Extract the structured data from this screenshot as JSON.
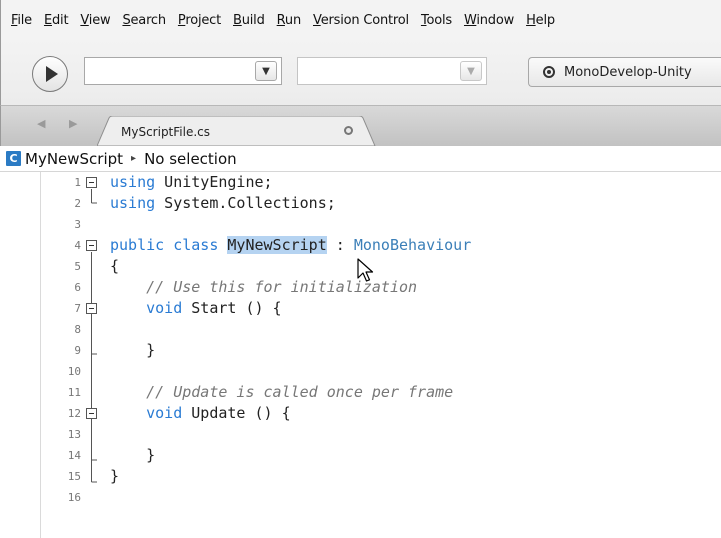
{
  "menu": [
    {
      "label": "File",
      "key": "F",
      "rest": "ile"
    },
    {
      "label": "Edit",
      "key": "E",
      "rest": "dit"
    },
    {
      "label": "View",
      "key": "V",
      "rest": "iew"
    },
    {
      "label": "Search",
      "key": "S",
      "rest": "earch"
    },
    {
      "label": "Project",
      "key": "P",
      "rest": "roject"
    },
    {
      "label": "Build",
      "key": "B",
      "rest": "uild"
    },
    {
      "label": "Run",
      "key": "R",
      "rest": "un"
    },
    {
      "label": "Version Control",
      "key": "V",
      "rest": "ersion Control"
    },
    {
      "label": "Tools",
      "key": "T",
      "rest": "ools"
    },
    {
      "label": "Window",
      "key": "W",
      "rest": "indow"
    },
    {
      "label": "Help",
      "key": "H",
      "rest": "elp"
    }
  ],
  "toolbar": {
    "run_icon": "play-icon",
    "configuration_value": "",
    "platform_value": "",
    "target_label": "MonoDevelop-Unity",
    "target_icon": "radio-target-icon"
  },
  "tabs": [
    {
      "label": "MyScriptFile.cs",
      "modified_icon": "unsaved-dot-icon"
    }
  ],
  "breadcrumb": {
    "icon_letter": "C",
    "class_name": "MyNewScript",
    "separator": "▸",
    "member": "No selection"
  },
  "editor": {
    "lines": [
      {
        "n": "1",
        "text": "using UnityEngine;"
      },
      {
        "n": "2",
        "text": "using System.Collections;"
      },
      {
        "n": "3",
        "text": ""
      },
      {
        "n": "4",
        "text": "public class MyNewScript : MonoBehaviour"
      },
      {
        "n": "5",
        "text": "{"
      },
      {
        "n": "6",
        "text": "// Use this for initialization"
      },
      {
        "n": "7",
        "text": "void Start () {"
      },
      {
        "n": "8",
        "text": ""
      },
      {
        "n": "9",
        "text": "}"
      },
      {
        "n": "10",
        "text": ""
      },
      {
        "n": "11",
        "text": "// Update is called once per frame"
      },
      {
        "n": "12",
        "text": "void Update () {"
      },
      {
        "n": "13",
        "text": ""
      },
      {
        "n": "14",
        "text": "}"
      },
      {
        "n": "15",
        "text": "}"
      },
      {
        "n": "16",
        "text": ""
      }
    ],
    "selected_text": "MyNewScript"
  },
  "colors": {
    "keyword": "#2a7bd3",
    "comment": "#777777",
    "selection": "#b5d3f1",
    "class_icon": "#2b7bc4"
  }
}
